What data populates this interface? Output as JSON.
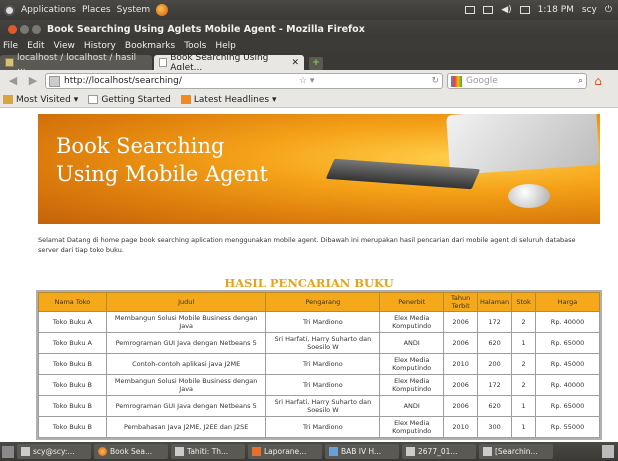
{
  "panel": {
    "menus": [
      "Applications",
      "Places",
      "System"
    ],
    "time": "1:18 PM",
    "user": "scy"
  },
  "window": {
    "title": "Book Searching Using Aglets Mobile Agent - Mozilla Firefox"
  },
  "menubar": [
    "File",
    "Edit",
    "View",
    "History",
    "Bookmarks",
    "Tools",
    "Help"
  ],
  "tabs": [
    {
      "label": "localhost / localhost / hasil ..."
    },
    {
      "label": "Book Searching Using Aglet..."
    }
  ],
  "nav": {
    "url": "http://localhost/searching/",
    "search_placeholder": "Google"
  },
  "bookmarks": [
    "Most Visited",
    "Getting Started",
    "Latest Headlines"
  ],
  "page": {
    "banner_title_line1": "Book Searching",
    "banner_title_line2": "Using Mobile Agent",
    "intro": "Selamat Datang di home page book searching aplication menggunakan mobile agent. Dibawah ini merupakan hasil pencarian dari mobile agent di seluruh database server dari tiap toko buku.",
    "heading": "HASIL PENCARIAN BUKU",
    "columns": [
      "Nama Toko",
      "Judul",
      "Pengarang",
      "Penerbit",
      "Tahun Terbit",
      "Halaman",
      "Stok",
      "Harga"
    ],
    "rows": [
      [
        "Toko Buku A",
        "Membangun Solusi Mobile Business dengan Java",
        "Tri Mardiono",
        "Elex Media Komputindo",
        "2006",
        "172",
        "2",
        "Rp. 40000"
      ],
      [
        "Toko Buku A",
        "Pemrograman GUI Java dengan Netbeans 5",
        "Sri Harfati, Harry Suharto dan Soesilo W",
        "ANDI",
        "2006",
        "620",
        "1",
        "Rp. 65000"
      ],
      [
        "Toko Buku B",
        "Contoh-contoh aplikasi java J2ME",
        "Tri Mardiono",
        "Elex Media Komputindo",
        "2010",
        "200",
        "2",
        "Rp. 45000"
      ],
      [
        "Toko Buku B",
        "Membangun Solusi Mobile Business dengan Java",
        "Tri Mardiono",
        "Elex Media Komputindo",
        "2006",
        "172",
        "2",
        "Rp. 40000"
      ],
      [
        "Toko Buku B",
        "Pemrograman GUI Java dengan Netbeans 5",
        "Sri Harfati, Harry Suharto dan Soesilo W",
        "ANDI",
        "2006",
        "620",
        "1",
        "Rp. 65000"
      ],
      [
        "Toko Buku B",
        "Pembahasan Java J2ME, J2EE dan J2SE",
        "Tri Mardiono",
        "Elex Media Komputindo",
        "2010",
        "300",
        "1",
        "Rp. 55000"
      ]
    ]
  },
  "taskbar": [
    "scy@scy:...",
    "Book Sea...",
    "Tahiti: Th...",
    "Laporane...",
    "BAB IV H...",
    "2677_01...",
    "[Searchin..."
  ]
}
